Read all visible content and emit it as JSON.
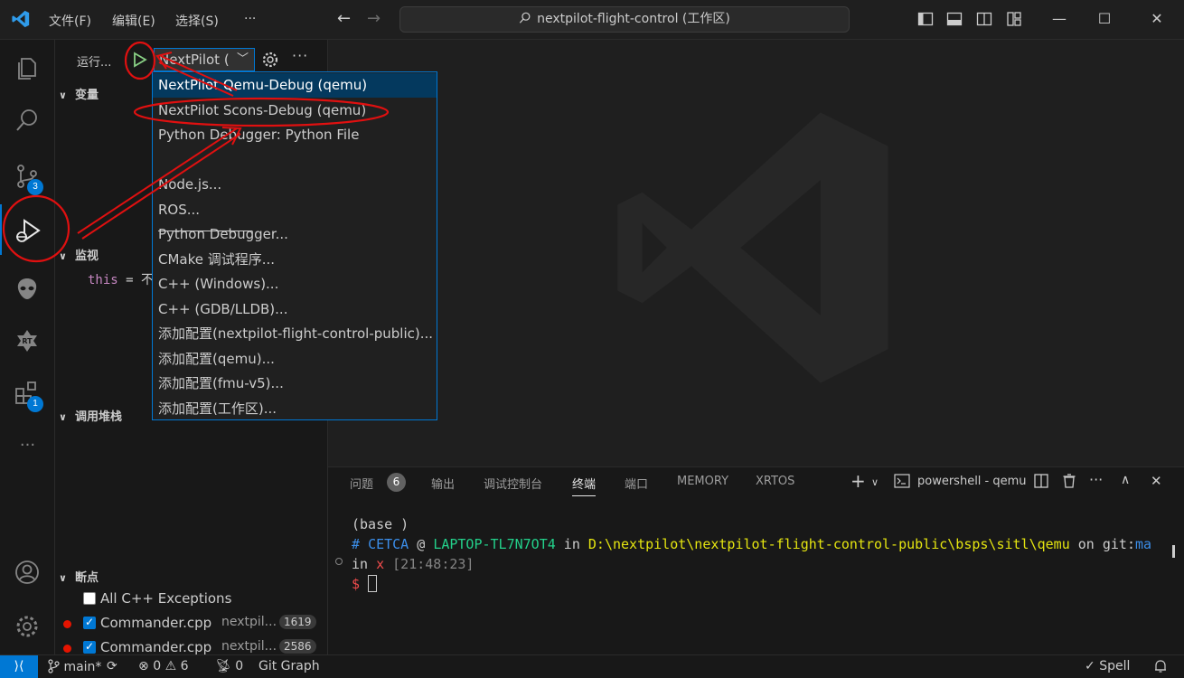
{
  "titlebar": {
    "menus": [
      "文件(F)",
      "编辑(E)",
      "选择(S)",
      "···"
    ],
    "search_text": "nextpilot-flight-control (工作区)"
  },
  "activity_bar": {
    "badges": {
      "source_control": "3",
      "extensions": "1"
    }
  },
  "sidebar": {
    "run_label": "运行...",
    "config_selected": "NextPilot (",
    "sections": {
      "variables": "变量",
      "watch": "监视",
      "call_stack": "调用堆栈",
      "breakpoints": "断点"
    },
    "watch_expr": {
      "name": "this",
      "op": " = ",
      "value": "不"
    },
    "breakpoints": [
      {
        "name": "All C++ Exceptions",
        "checked": false,
        "dot": false,
        "file": "",
        "line": ""
      },
      {
        "name": "Commander.cpp",
        "checked": true,
        "dot": true,
        "file": "nextpil...",
        "line": "1619"
      },
      {
        "name": "Commander.cpp",
        "checked": true,
        "dot": true,
        "file": "nextpil...",
        "line": "2586"
      }
    ]
  },
  "dropdown": {
    "items": [
      "NextPilot Qemu-Debug (qemu)",
      "NextPilot Scons-Debug (qemu)",
      "Python Debugger: Python File",
      "",
      "Node.js...",
      "ROS...",
      "Python Debugger...",
      "CMake 调试程序...",
      "C++ (Windows)...",
      "C++ (GDB/LLDB)...",
      "添加配置(nextpilot-flight-control-public)...",
      "添加配置(qemu)...",
      "添加配置(fmu-v5)...",
      "添加配置(工作区)..."
    ],
    "selected_index": 0
  },
  "panel": {
    "tabs": [
      "问题",
      "输出",
      "调试控制台",
      "终端",
      "端口",
      "MEMORY",
      "XRTOS"
    ],
    "problems_count": "6",
    "active_tab": "终端",
    "terminal_name": "powershell - qemu",
    "terminal": {
      "l1": "(base )",
      "l2_hash": "# ",
      "l2_user": "CETCA",
      "l2_at": " @ ",
      "l2_host": "LAPTOP-TL7N7OT4",
      "l2_in": " in ",
      "l2_path": "D:\\nextpilot\\nextpilot-flight-control-public\\bsps\\sitl\\qemu",
      "l2_on": " on ",
      "l2_git": "git:",
      "l2_branch": "ma",
      "l3_in": "in ",
      "l3_x": "x",
      "l3_time": " [21:48:23]",
      "l4_prompt": "$ "
    }
  },
  "statusbar": {
    "branch": "main*",
    "errors": "0",
    "warnings": "6",
    "ports": "0",
    "git_graph": "Git Graph",
    "spell": "Spell"
  },
  "colors": {
    "accent": "#0078d4",
    "annotation": "#e01010",
    "breakpoint": "#e51400"
  }
}
